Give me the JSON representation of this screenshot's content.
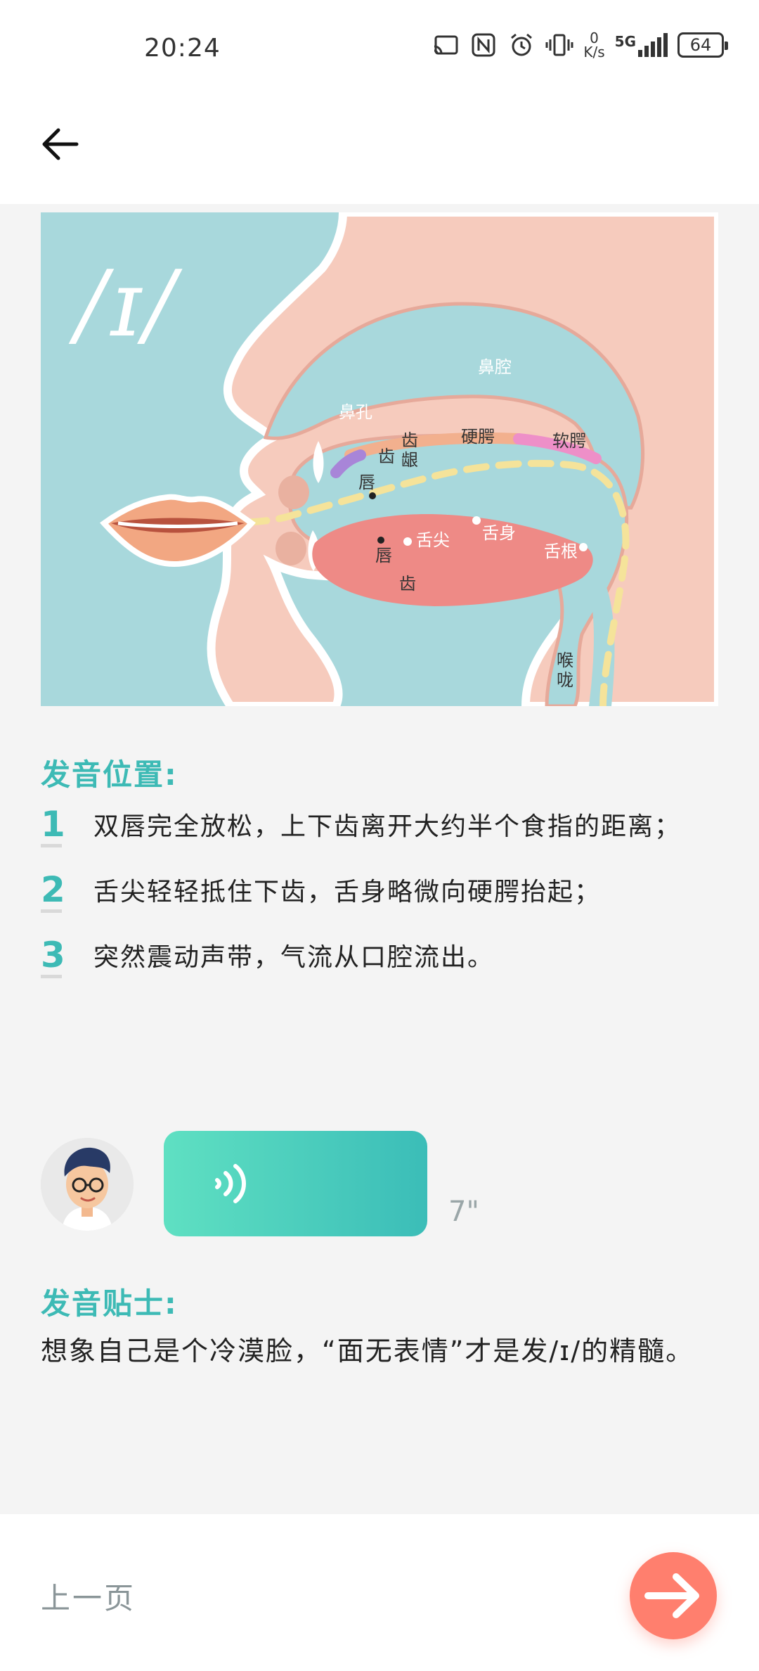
{
  "status_bar": {
    "time": "20:24",
    "net_speed_value": "0",
    "net_speed_unit": "K/s",
    "network": "5G",
    "battery": "64",
    "icons": [
      "cast-icon",
      "nfc-icon",
      "alarm-icon",
      "vibrate-icon",
      "signal-icon",
      "battery-icon"
    ]
  },
  "header": {
    "back_icon": "arrow-left-icon"
  },
  "illustration": {
    "phoneme": "/ɪ/",
    "labels": {
      "nasal_cavity": "鼻腔",
      "nostril": "鼻孔",
      "upper_teeth": "齿",
      "gums_1": "齿",
      "gums_2": "龈",
      "hard_palate": "硬腭",
      "soft_palate": "软腭",
      "upper_lip": "唇",
      "tongue_tip": "舌尖",
      "tongue_body": "舌身",
      "tongue_root": "舌根",
      "lower_lip": "唇",
      "lower_teeth": "齿",
      "throat_1": "喉",
      "throat_2": "咙"
    },
    "colors": {
      "background": "#a8d8dc",
      "flesh": "#f6cbbd",
      "tongue": "#ee8a86",
      "airflow": "#f5e39a"
    }
  },
  "position_section": {
    "title": "发音位置:",
    "steps": [
      {
        "num": "1",
        "text": "双唇完全放松，上下齿离开大约半个食指的距离；"
      },
      {
        "num": "2",
        "text": "舌尖轻轻抵住下齿，舌身略微向硬腭抬起；"
      },
      {
        "num": "3",
        "text": "突然震动声带，气流从口腔流出。"
      }
    ]
  },
  "audio": {
    "duration": "7\"",
    "icon": "sound-wave-icon"
  },
  "tip_section": {
    "title": "发音贴士:",
    "text": "想象自己是个冷漠脸，“面无表情”才是发/ɪ/的精髓。"
  },
  "bottom": {
    "prev_label": "上一页",
    "next_icon": "arrow-right-icon",
    "accent": "#ff7f6e"
  },
  "theme": {
    "accent": "#3dbab5"
  }
}
